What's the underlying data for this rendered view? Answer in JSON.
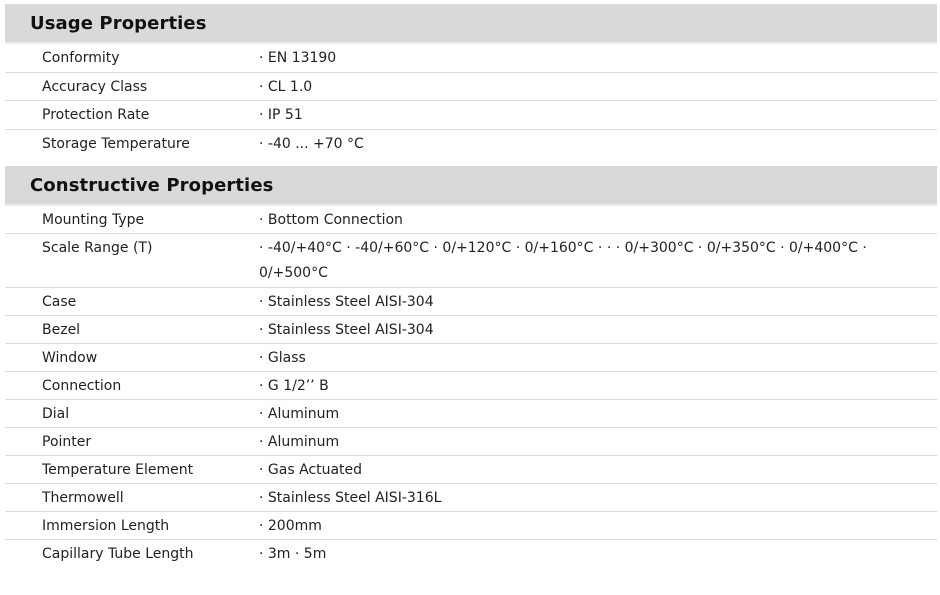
{
  "sections": [
    {
      "title": "Usage Properties",
      "rows": [
        {
          "label": "Conformity",
          "value": "· EN 13190"
        },
        {
          "label": "Accuracy Class",
          "value": "· CL 1.0"
        },
        {
          "label": "Protection Rate",
          "value": "· IP 51"
        },
        {
          "label": "Storage Temperature",
          "value": "· -40 ... +70 °C"
        }
      ]
    },
    {
      "title": "Constructive Properties",
      "rows": [
        {
          "label": "Mounting Type",
          "value": "· Bottom Connection"
        },
        {
          "label": "Scale Range (T)",
          "value": "· -40/+40°C · -40/+60°C · 0/+120°C · 0/+160°C · · · 0/+300°C · 0/+350°C · 0/+400°C · 0/+500°C"
        },
        {
          "label": "Case",
          "value": "· Stainless Steel AISI-304"
        },
        {
          "label": "Bezel",
          "value": "· Stainless Steel AISI-304"
        },
        {
          "label": "Window",
          "value": "· Glass"
        },
        {
          "label": "Connection",
          "value": "· G 1/2’’ B"
        },
        {
          "label": "Dial",
          "value": "· Aluminum"
        },
        {
          "label": "Pointer",
          "value": "· Aluminum"
        },
        {
          "label": "Temperature Element",
          "value": "· Gas Actuated"
        },
        {
          "label": "Thermowell",
          "value": "· Stainless Steel AISI-316L"
        },
        {
          "label": "Immersion Length",
          "value": "· 200mm"
        },
        {
          "label": "Capillary Tube Length",
          "value": "· 3m · 5m"
        }
      ]
    }
  ]
}
